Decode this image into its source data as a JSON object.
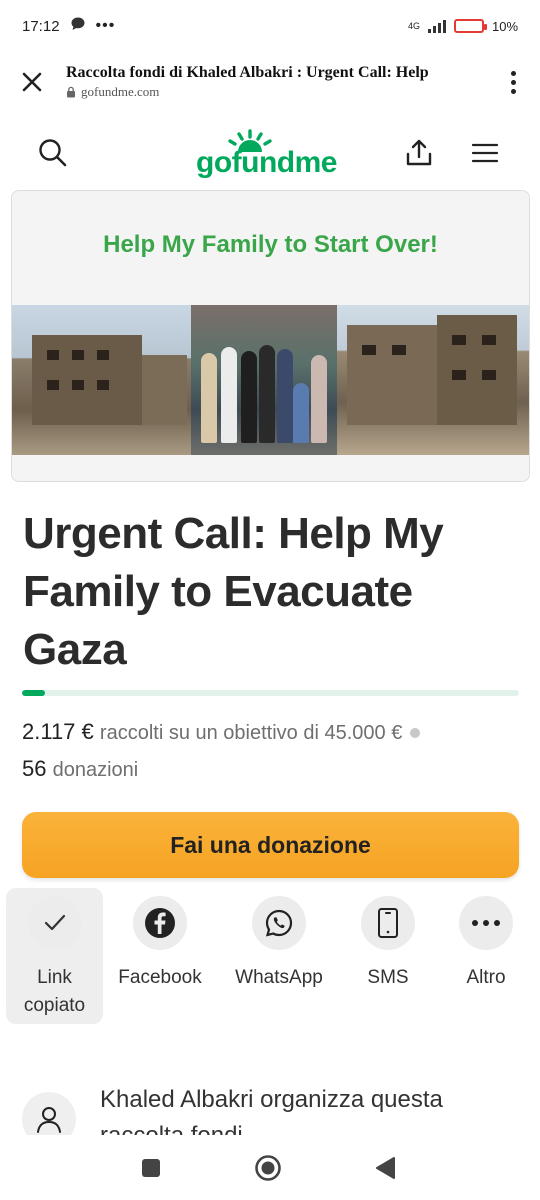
{
  "status_bar": {
    "time": "17:12",
    "network": "4G",
    "battery": "10",
    "battery_level": 0.1
  },
  "browser": {
    "page_title": "Raccolta fondi di Khaled Albakri : Urgent Call: Help",
    "domain": "gofundme.com"
  },
  "header": {
    "logo": "gofundme",
    "brand_color": "#02a95c"
  },
  "hero": {
    "banner_text": "Help My Family to Start Over!"
  },
  "campaign": {
    "title": "Urgent Call: Help My Family to Evacuate Gaza",
    "progress_fraction": 0.047,
    "raised": "2.117 €",
    "goal_text": "raccolti su un obiettivo di 45.000 €",
    "donations_count": "56",
    "donations_label": "donazioni"
  },
  "donate_button": {
    "label": "Fai una donazione",
    "color": "#f5a323"
  },
  "share": {
    "items": [
      {
        "label": "Link copiato",
        "icon": "check-icon"
      },
      {
        "label": "Facebook",
        "icon": "facebook-icon"
      },
      {
        "label": "WhatsApp",
        "icon": "whatsapp-icon"
      },
      {
        "label": "SMS",
        "icon": "phone-icon"
      },
      {
        "label": "Altro",
        "icon": "more-icon"
      }
    ]
  },
  "organizer": {
    "text": "Khaled Albakri organizza questa raccolta fondi."
  }
}
